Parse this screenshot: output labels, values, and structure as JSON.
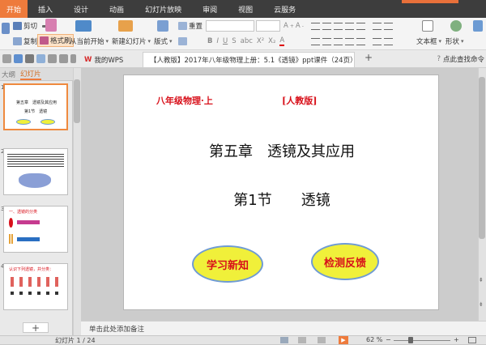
{
  "menubar": {
    "items": [
      "开始",
      "插入",
      "设计",
      "动画",
      "幻灯片放映",
      "审阅",
      "视图",
      "云服务"
    ],
    "active_index": 0
  },
  "ribbon": {
    "cut": "剪切",
    "copy": "复制",
    "format_painter": "格式刷",
    "from_current": "从当前开始",
    "new_slide": "新建幻灯片",
    "layout": "版式",
    "reset": "重置",
    "textbox": "文本框",
    "shape": "形状"
  },
  "tabbar": {
    "home_tab": "我的WPS",
    "doc_tab": "【人教版】2017年八年级物理上册：5.1《透镜》ppt课件（24页）.ppt",
    "help_link": "点此查找命令"
  },
  "leftpane": {
    "tab_outline": "大纲",
    "tab_slides": "幻灯片",
    "thumbnails": [
      {
        "number": "1",
        "line1": "第五章　透镜及其应用",
        "line2": "第1节　透镜"
      },
      {
        "number": "2"
      },
      {
        "number": "3",
        "title": "一、透镜的分类"
      },
      {
        "number": "4",
        "title": "认识下列透镜，并分类："
      }
    ],
    "add_button": "+"
  },
  "slide": {
    "header_left": "八年级物理·上",
    "header_right": "[人教版]",
    "chapter": "第五章　透镜及其应用",
    "section": "第1节　　透镜",
    "button_learn": "学习新知",
    "button_check": "检测反馈"
  },
  "notes": {
    "placeholder": "单击此处添加备注"
  },
  "status": {
    "slide_counter": "幻灯片 1 / 24",
    "zoom": "62 %",
    "zoom_level": 62
  },
  "colors": {
    "accent": "#ee7b3c",
    "slide_red": "#d8101a",
    "button_yellow": "#f0f03a",
    "button_border": "#6f9bd4"
  }
}
